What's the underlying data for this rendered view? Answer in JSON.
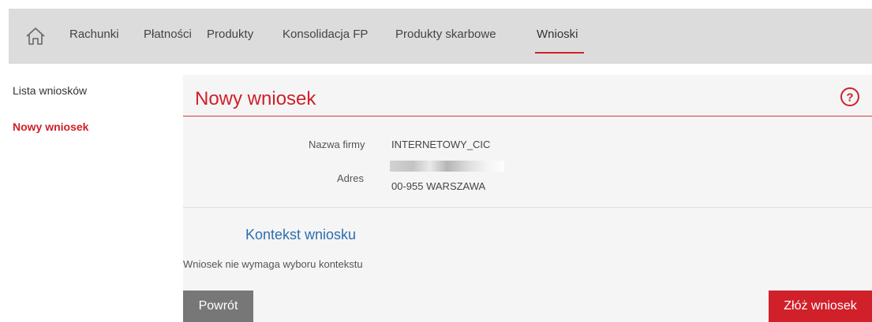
{
  "nav": {
    "items": [
      {
        "label": "Rachunki"
      },
      {
        "label": "Płatności"
      },
      {
        "label": "Produkty"
      },
      {
        "label": "Konsolidacja FP"
      },
      {
        "label": "Produkty skarbowe"
      },
      {
        "label": "Wnioski"
      }
    ],
    "active_index": 5
  },
  "sidebar": {
    "items": [
      {
        "label": "Lista wniosków"
      },
      {
        "label": "Nowy wniosek"
      }
    ],
    "active_index": 1
  },
  "main": {
    "title": "Nowy wniosek",
    "company": {
      "name_label": "Nazwa firmy",
      "name_value": "INTERNETOWY_CIC",
      "address_label": "Adres",
      "address_line2": "00-955 WARSZAWA"
    },
    "context": {
      "title": "Kontekst wniosku",
      "note": "Wniosek nie wymaga wyboru kontekstu"
    },
    "back_label": "Powrót",
    "submit_label": "Złóż wniosek"
  },
  "icons": {
    "home": "home-icon",
    "help": "help-icon"
  },
  "colors": {
    "accent": "#d0202a",
    "link_blue": "#2e6db0",
    "nav_bg": "#dcdcdc",
    "panel_bg": "#f5f5f5",
    "back_button": "#777777"
  }
}
